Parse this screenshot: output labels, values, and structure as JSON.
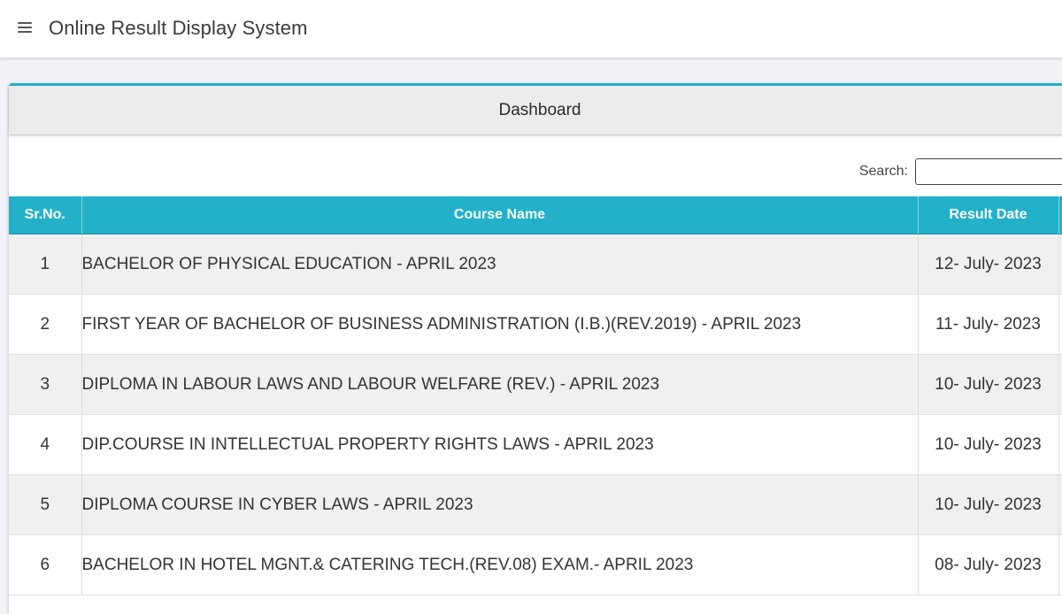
{
  "header": {
    "title": "Online Result Display System",
    "menu_icon": "hamburger-menu-icon"
  },
  "card": {
    "title": "Dashboard",
    "accent_color": "#22b1c8"
  },
  "search": {
    "label": "Search:",
    "value": "",
    "placeholder": ""
  },
  "table": {
    "columns": [
      "Sr.No.",
      "Course Name",
      "Result Date"
    ],
    "rows": [
      {
        "sr": "1",
        "course": "BACHELOR OF PHYSICAL EDUCATION - APRIL 2023",
        "date": "12- July- 2023"
      },
      {
        "sr": "2",
        "course": "FIRST YEAR OF BACHELOR OF BUSINESS ADMINISTRATION (I.B.)(REV.2019) - APRIL 2023",
        "date": "11- July- 2023"
      },
      {
        "sr": "3",
        "course": "DIPLOMA IN LABOUR LAWS AND LABOUR WELFARE (REV.) - APRIL 2023",
        "date": "10- July- 2023"
      },
      {
        "sr": "4",
        "course": "DIP.COURSE IN INTELLECTUAL PROPERTY RIGHTS LAWS - APRIL 2023",
        "date": "10- July- 2023"
      },
      {
        "sr": "5",
        "course": "DIPLOMA COURSE IN CYBER LAWS - APRIL 2023",
        "date": "10- July- 2023"
      },
      {
        "sr": "6",
        "course": "BACHELOR IN HOTEL MGNT.& CATERING TECH.(REV.08) EXAM.- APRIL 2023",
        "date": "08- July- 2023"
      }
    ]
  }
}
